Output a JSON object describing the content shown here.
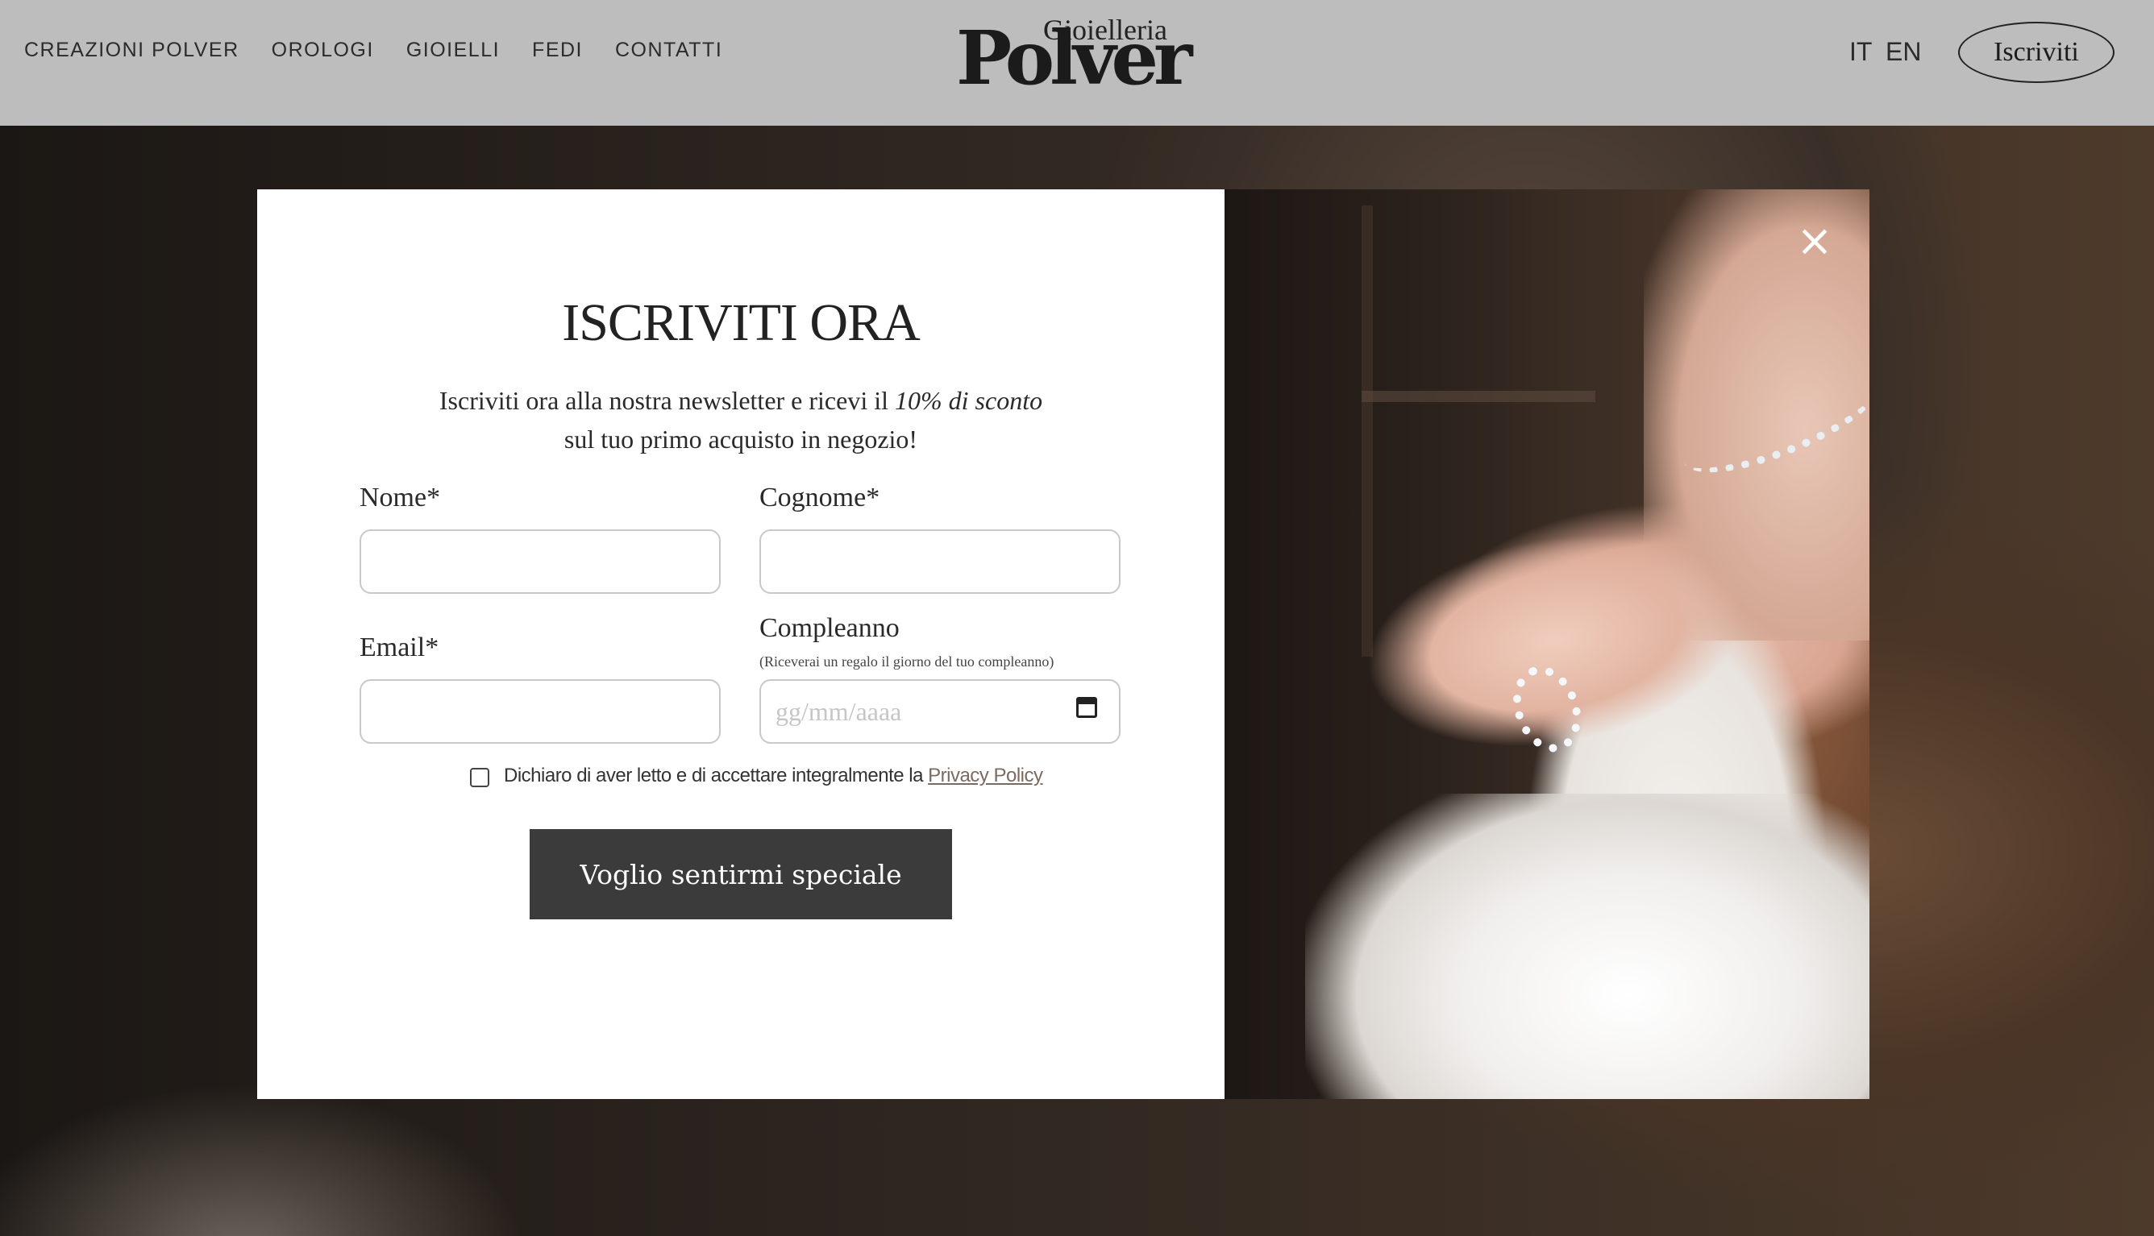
{
  "header": {
    "nav": [
      "CREAZIONI POLVER",
      "OROLOGI",
      "GIOIELLI",
      "FEDI",
      "CONTATTI"
    ],
    "logo_small": "Gioielleria",
    "logo_big": "Polver",
    "lang_it": "IT",
    "lang_en": "EN",
    "subscribe_button": "Iscriviti"
  },
  "modal": {
    "title": "ISCRIVITI ORA",
    "subtitle_line1_prefix": "Iscriviti ora alla nostra newsletter e ricevi il ",
    "subtitle_line1_emphasis": "10% di sconto",
    "subtitle_line2": "sul tuo primo acquisto in negozio!",
    "fields": {
      "nome_label": "Nome*",
      "nome_value": "",
      "cognome_label": "Cognome*",
      "cognome_value": "",
      "email_label": "Email*",
      "email_value": "",
      "compleanno_label": "Compleanno",
      "compleanno_hint": "(Riceverai un regalo il giorno del tuo compleanno)",
      "compleanno_placeholder": "gg/mm/aaaa"
    },
    "consent_text": "Dichiaro di aver letto e di accettare integralmente la ",
    "consent_link": "Privacy Policy",
    "submit_label": "Voglio sentirmi speciale",
    "close_symbol": "×"
  },
  "icons": {
    "close": "close-icon",
    "calendar": "calendar-icon"
  }
}
